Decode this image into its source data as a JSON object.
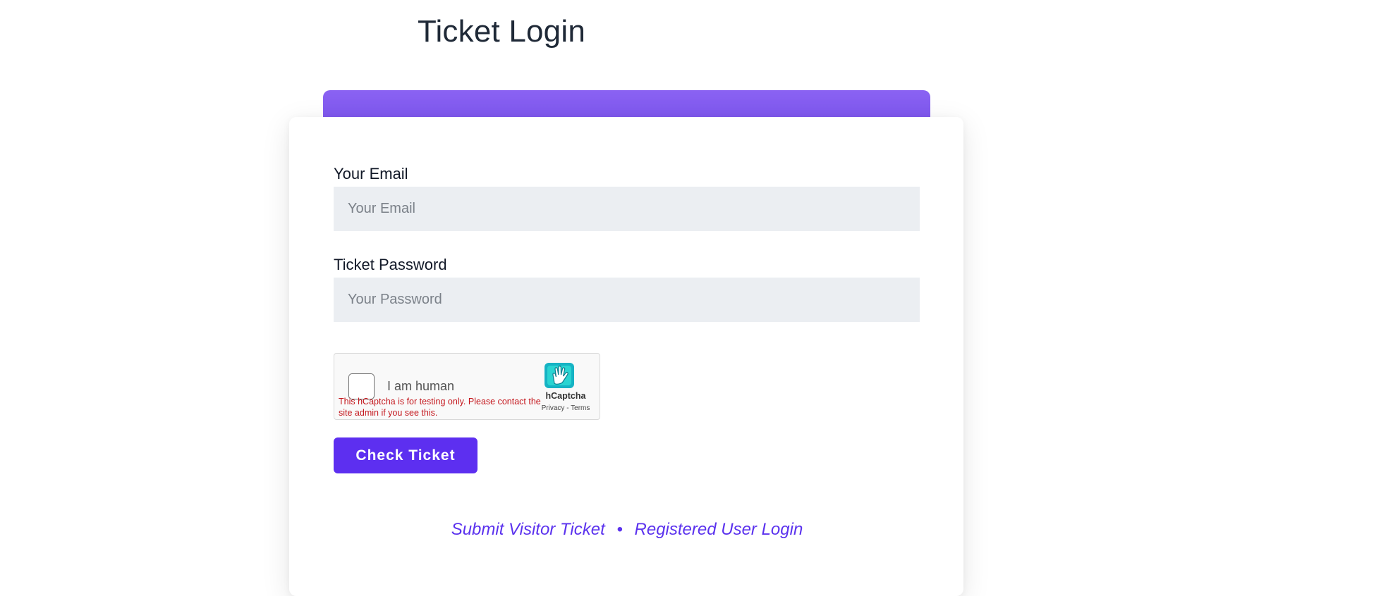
{
  "header": {
    "title": "Ticket Login"
  },
  "form": {
    "email_label": "Your Email",
    "email_placeholder": "Your Email",
    "email_value": "",
    "password_label": "Ticket Password",
    "password_placeholder": "Your Password",
    "password_value": "",
    "submit_label": "Check Ticket"
  },
  "captcha": {
    "label": "I am human",
    "warning": "This hCaptcha is for testing only. Please contact the site admin if you see this.",
    "brand": "hCaptcha",
    "privacy_label": "Privacy",
    "separator": "-",
    "terms_label": "Terms",
    "logo_icon": "hcaptcha-hand-icon",
    "checkbox_checked": false
  },
  "footer": {
    "visitor_link": "Submit Visitor Ticket",
    "separator": "•",
    "registered_link": "Registered User Login"
  },
  "colors": {
    "accent": "#5d2ff0",
    "card_top": "#7c55ee",
    "link": "#5b32ee",
    "input_bg": "#ebeef2",
    "warning": "#c4161c"
  }
}
